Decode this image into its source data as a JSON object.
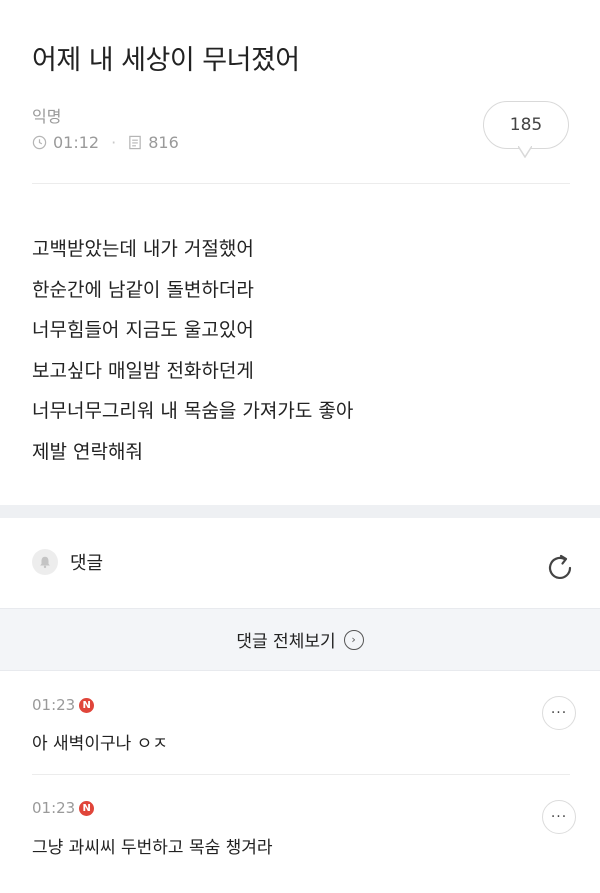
{
  "post": {
    "title": "어제 내 세상이 무너졌어",
    "author": "익명",
    "time": "01:12",
    "views": "816",
    "comment_count": "185",
    "body_lines": [
      "고백받았는데 내가 거절했어",
      "한순간에 남같이 돌변하더라",
      "너무힘들어 지금도 울고있어",
      "보고싶다 매일밤 전화하던게",
      "너무너무그리워 내 목숨을 가져가도 좋아",
      "제발 연락해줘"
    ]
  },
  "comments_section": {
    "label": "댓글",
    "view_all_label": "댓글 전체보기",
    "view_all_chevron": "›"
  },
  "comments": [
    {
      "time": "01:23",
      "badge": "N",
      "text": "아 새벽이구나 ㅇㅈ",
      "more": "···"
    },
    {
      "time": "01:23",
      "badge": "N",
      "text": "그냥 과씨씨 두번하고 목숨 챙겨라",
      "more": "···"
    }
  ],
  "colors": {
    "badge": "#e0453a",
    "meta_text": "#9a9a9a",
    "section_band": "#eef0f3"
  },
  "icons": {
    "clock": "clock-icon",
    "views": "document-icon",
    "bell": "bell-icon",
    "refresh": "refresh-icon",
    "chevron": "chevron-right-circle-icon",
    "more": "more-icon"
  }
}
